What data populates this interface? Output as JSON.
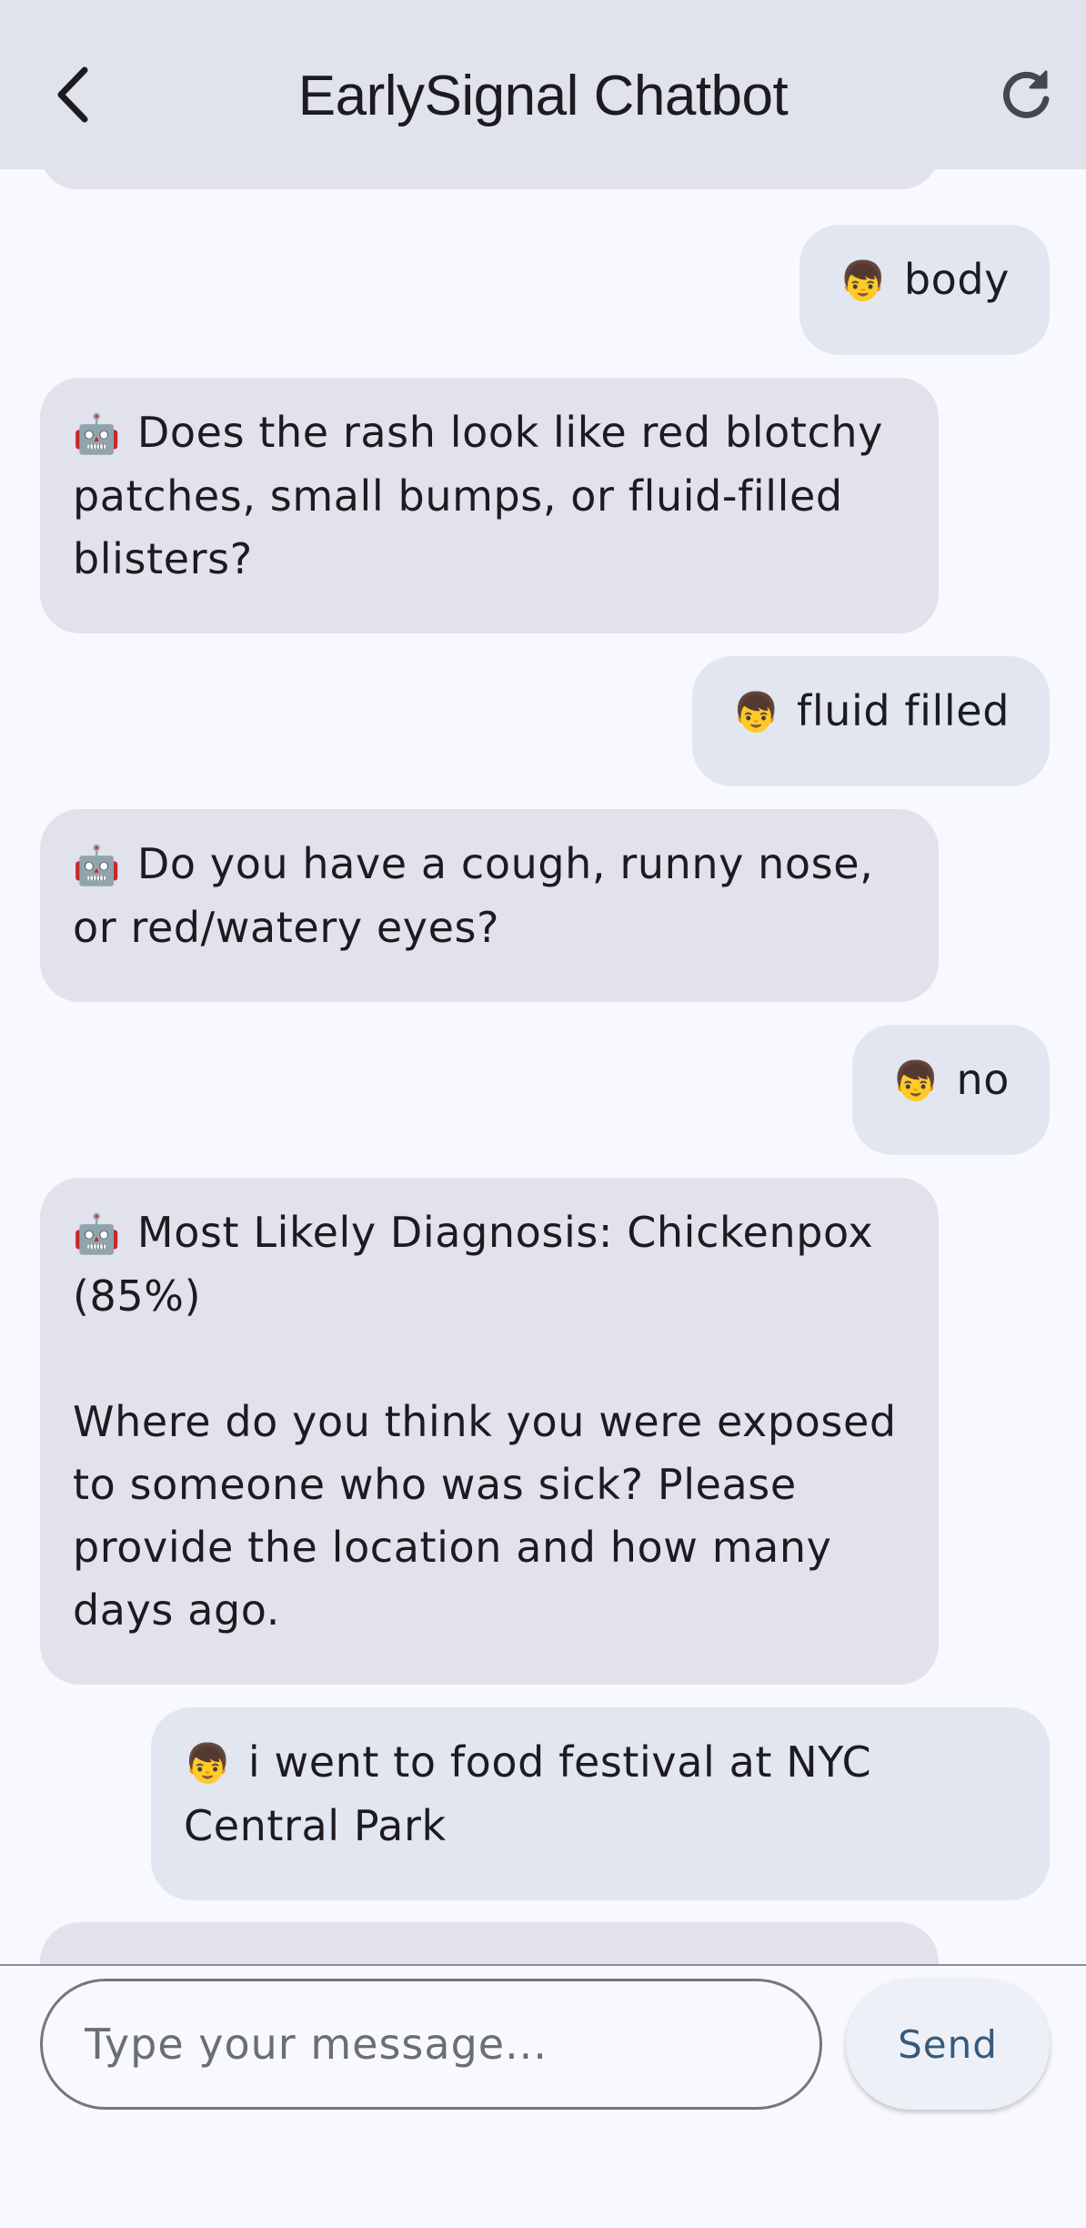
{
  "app_bar": {
    "title": "EarlySignal Chatbot",
    "back_icon": "chevron-left-icon",
    "refresh_icon": "refresh-icon"
  },
  "messages": [
    {
      "sender": "bot",
      "icon": "🤖",
      "text": ""
    },
    {
      "sender": "user",
      "icon": "👦",
      "text": "body"
    },
    {
      "sender": "bot",
      "icon": "🤖",
      "text": "Does the rash look like red blotchy patches, small bumps, or fluid-filled blisters?"
    },
    {
      "sender": "user",
      "icon": "👦",
      "text": "fluid filled"
    },
    {
      "sender": "bot",
      "icon": "🤖",
      "text": "Do you have a cough, runny nose, or red/watery eyes?"
    },
    {
      "sender": "user",
      "icon": "👦",
      "text": "no"
    },
    {
      "sender": "bot",
      "icon": "🤖",
      "text": "Most Likely Diagnosis: Chickenpox (85%)\n\nWhere do you think you were exposed to someone who was sick? Please provide the location and how many days ago."
    },
    {
      "sender": "user",
      "icon": "👦",
      "text": "i went to food festival at NYC Central Park"
    },
    {
      "sender": "bot",
      "icon": "🤖",
      "text": ""
    }
  ],
  "composer": {
    "placeholder": "Type your message...",
    "value": "",
    "send_label": "Send"
  },
  "colors": {
    "app_bar_bg": "#e0e2ec",
    "page_bg": "#f8f9fe",
    "bot_bubble": "#e1e2eb",
    "user_bubble": "#e1e6f0",
    "send_text": "#375a7a"
  }
}
